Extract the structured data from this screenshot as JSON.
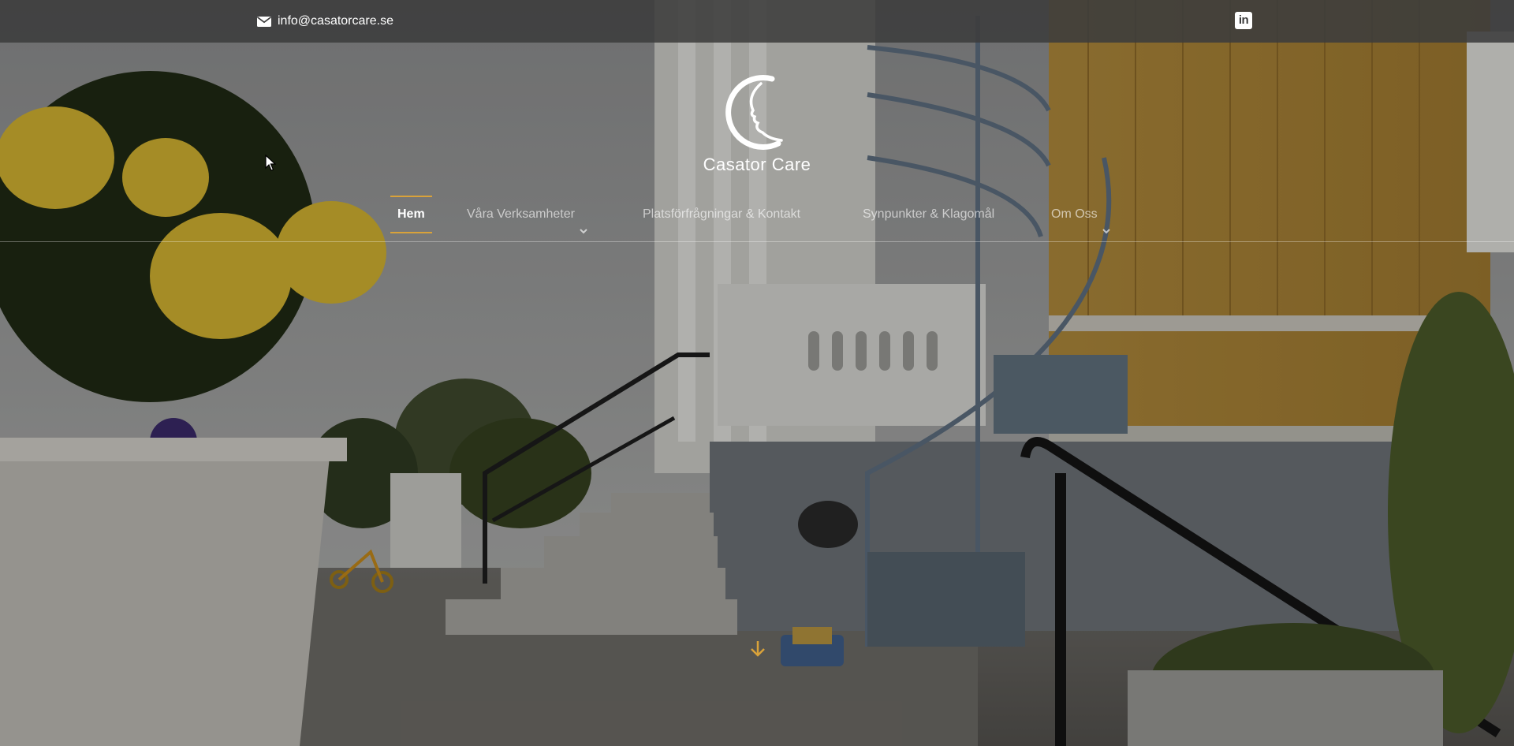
{
  "topbar": {
    "email": "info@casatorcare.se",
    "email_icon": "envelope-icon",
    "social_icon": "linkedin-icon",
    "social_label": "in"
  },
  "logo": {
    "name": "Casator Care"
  },
  "nav": {
    "items": [
      {
        "label": "Hem",
        "active": true,
        "has_dropdown": false
      },
      {
        "label": "Våra Verksamheter",
        "active": false,
        "has_dropdown": true
      },
      {
        "label": "Platsförfrågningar & Kontakt",
        "active": false,
        "has_dropdown": false
      },
      {
        "label": "Synpunkter & Klagomål",
        "active": false,
        "has_dropdown": false
      },
      {
        "label": "Om Oss",
        "active": false,
        "has_dropdown": true
      }
    ]
  },
  "hero": {
    "scroll_icon": "arrow-down-icon"
  },
  "colors": {
    "accent": "#d9a23a",
    "topbar": "#3c3c3c",
    "text": "#ffffff"
  }
}
